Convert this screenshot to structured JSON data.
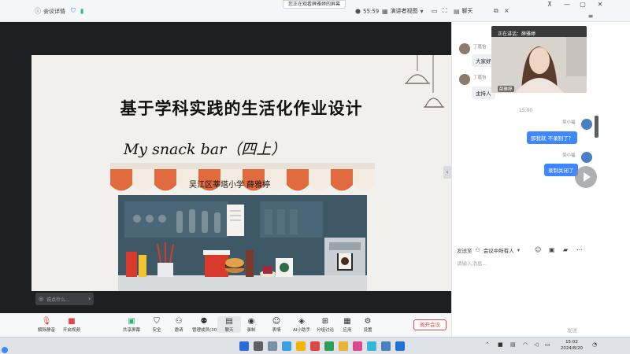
{
  "titlebar": {
    "meeting_info": "会议详情",
    "share_banner": "您正在观看薛雅婷的屏幕",
    "timer": "55:59",
    "view_mode": "演讲者视图",
    "chat_title": "聊天"
  },
  "slide": {
    "title": "基于学科实践的生活化作业设计",
    "subtitle": "My snack bar（四上）",
    "school_author": "吴江区莘塔小学   薛雅婷"
  },
  "floating_chat": {
    "placeholder": "说点什么..."
  },
  "toolbar": {
    "mute": "解除静音",
    "video": "开启视频",
    "share": "共享屏幕",
    "security": "安全",
    "invite": "邀请",
    "members": "管理成员(30)",
    "chat": "聊天",
    "record": "录制",
    "reactions": "表情",
    "ai": "AI小助手",
    "breakout": "分组讨论",
    "apps": "应用",
    "settings": "设置",
    "leave": "离开会议"
  },
  "chat": {
    "speaker_label": "正在讲话：薛雅婷",
    "speaker_name": "薛雅婷",
    "messages": [
      {
        "sender": "丁嘉怡",
        "text": "大家好",
        "direction": "in"
      },
      {
        "sender": "丁嘉怡",
        "text": "主持人",
        "direction": "in"
      },
      {
        "sender": "吴小福",
        "text": "那我就 不录制了？",
        "direction": "out"
      },
      {
        "sender": "吴小福",
        "text": "录制关闭了",
        "direction": "out"
      }
    ],
    "time_divider": "15:00",
    "send_to_label": "发送至",
    "send_to_target": "会议中所有人",
    "input_placeholder": "请输入消息...",
    "send_label": "发送"
  },
  "taskbar": {
    "time": "15:02",
    "date": "2024/8/20"
  },
  "colors": {
    "accent_blue": "#3f87ff",
    "leave_red": "#e04848",
    "stage_bg": "#1e1f21"
  }
}
